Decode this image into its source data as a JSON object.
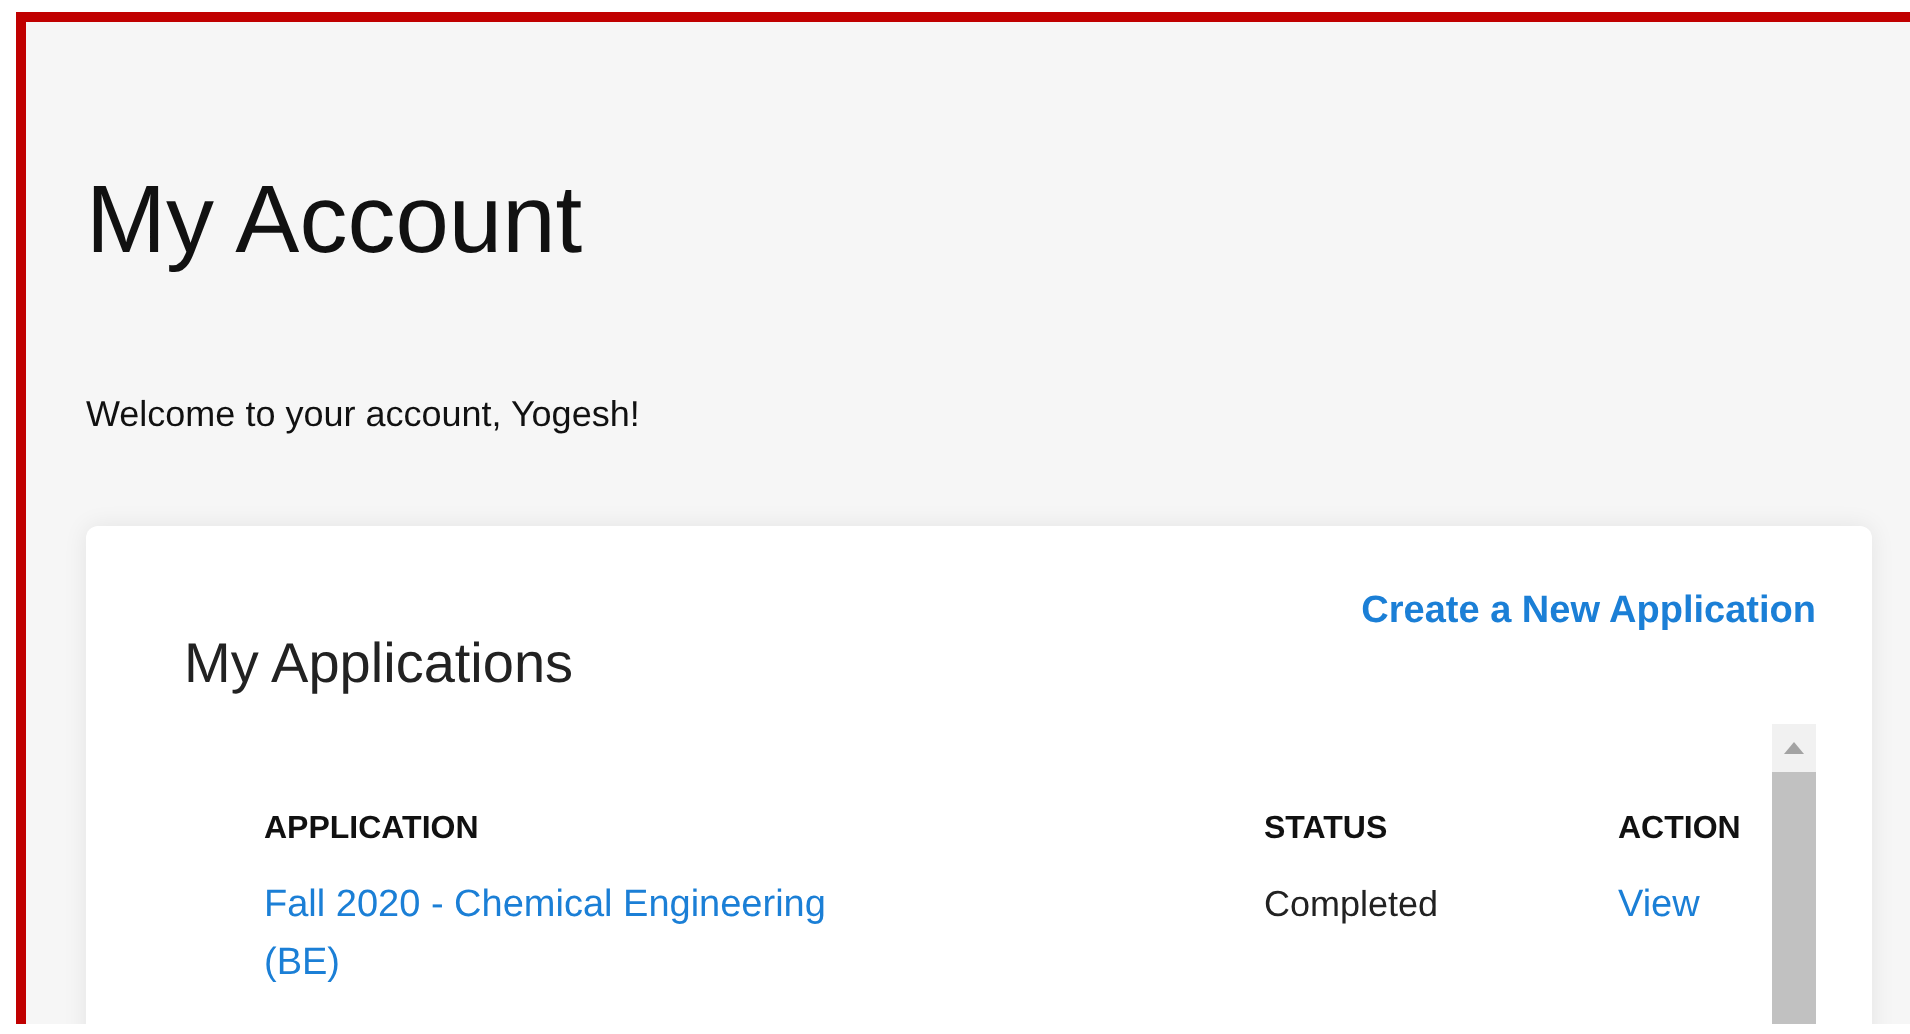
{
  "page": {
    "title": "My Account",
    "welcome": "Welcome to your account, Yogesh!"
  },
  "applications": {
    "title": "My Applications",
    "create_link": "Create a New Application",
    "table": {
      "columns": [
        "APPLICATION",
        "STATUS",
        "ACTION"
      ],
      "rows": [
        {
          "application": "Fall 2020 - Chemical Engineering (BE)",
          "status": "Completed",
          "action": "View"
        }
      ]
    }
  }
}
